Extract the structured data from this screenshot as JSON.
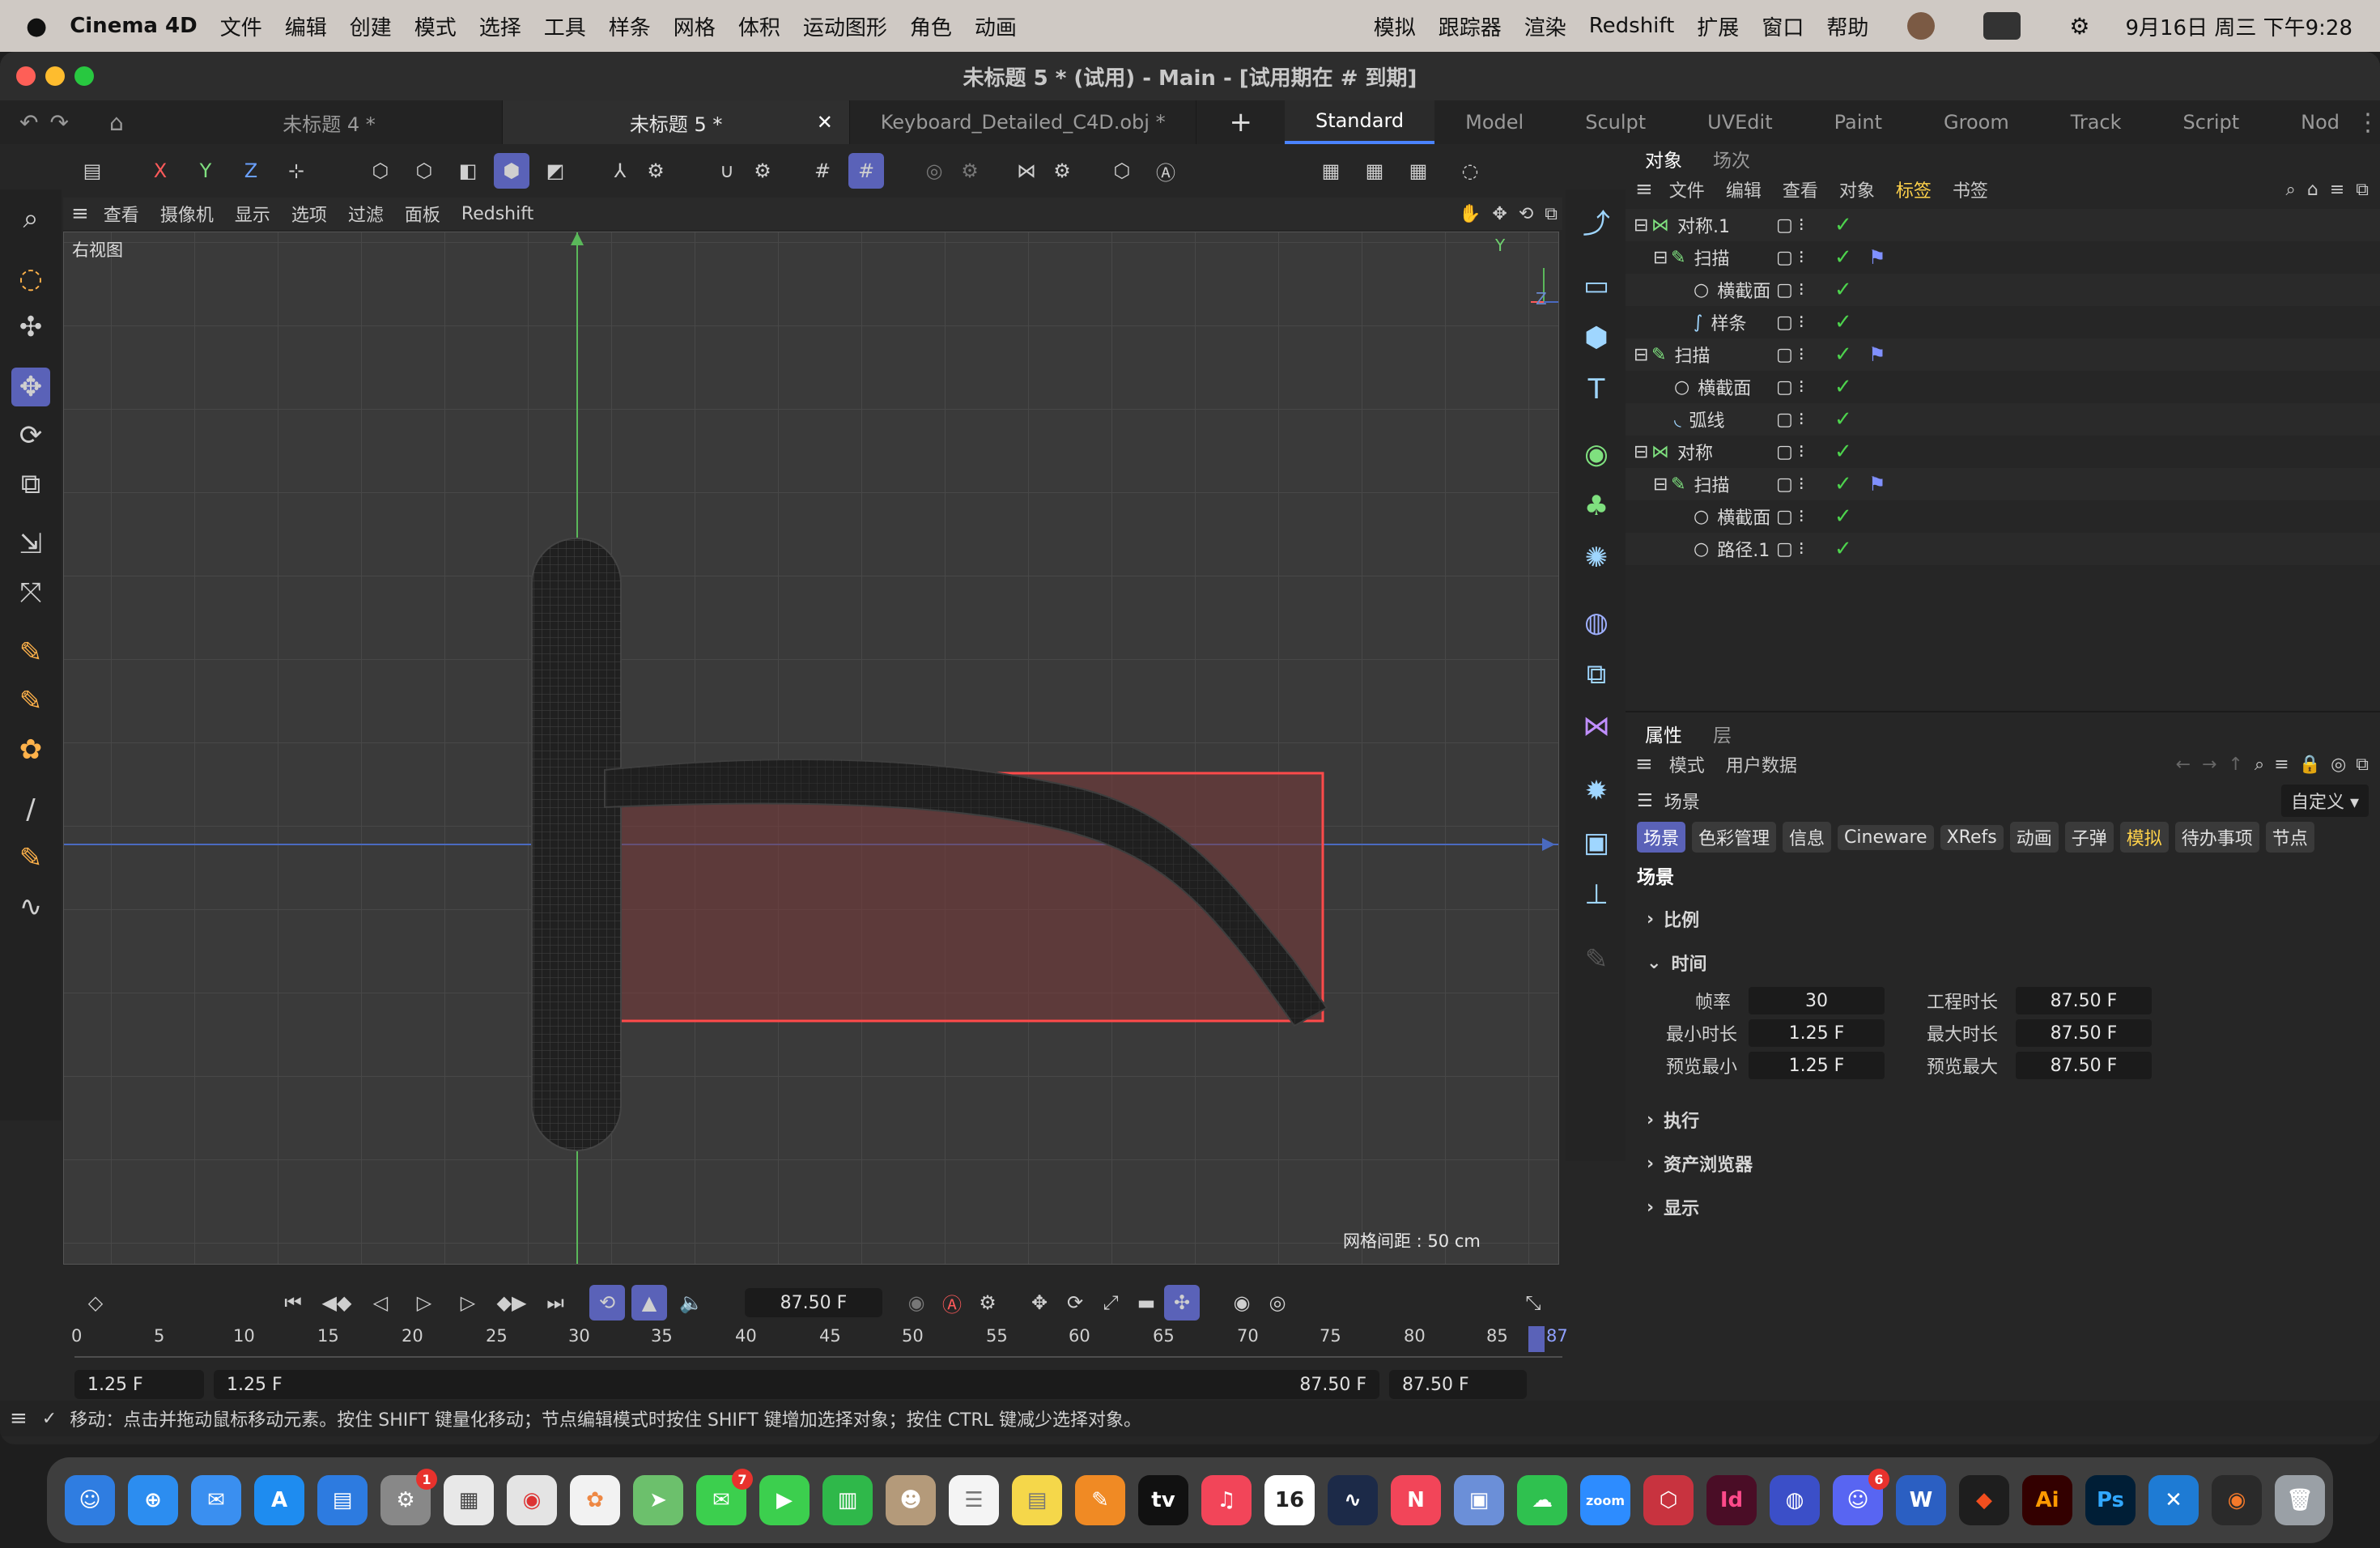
{
  "menubar": {
    "app": "Cinema 4D",
    "items": [
      "文件",
      "编辑",
      "创建",
      "模式",
      "选择",
      "工具",
      "样条",
      "网格",
      "体积",
      "运动图形",
      "角色",
      "动画"
    ],
    "right_items": [
      "模拟",
      "跟踪器",
      "渲染",
      "Redshift",
      "扩展",
      "窗口",
      "帮助"
    ],
    "clock": "9月16日 周三  下午9:28"
  },
  "window": {
    "title": "未标题 5 * (试用) - Main - [试用期在 # 到期]",
    "doc_tabs": [
      {
        "label": "未标题 4 *"
      },
      {
        "label": "未标题 5 *",
        "close": "✕"
      },
      {
        "label": "Keyboard_Detailed_C4D.obj *"
      }
    ],
    "add_tab": "+",
    "layouts": [
      "Standard",
      "Model",
      "Sculpt",
      "UVEdit",
      "Paint",
      "Groom",
      "Track",
      "Script",
      "Nod"
    ],
    "axes": {
      "x": "X",
      "y": "Y",
      "z": "Z"
    }
  },
  "viewport": {
    "menu": [
      "查看",
      "摄像机",
      "显示",
      "选项",
      "过滤",
      "面板",
      "Redshift"
    ],
    "name": "右视图",
    "grid_note": "网格间距 : 50 cm",
    "axis_y": "Y",
    "axis_z": "Z"
  },
  "timeline": {
    "current_frame": "87.50 F",
    "ruler": [
      "0",
      "5",
      "10",
      "15",
      "20",
      "25",
      "30",
      "35",
      "40",
      "45",
      "50",
      "55",
      "60",
      "65",
      "70",
      "75",
      "80",
      "85",
      "87"
    ],
    "range_min": "1.25 F",
    "range_start": "1.25 F",
    "range_end": "87.50 F",
    "range_max": "87.50 F"
  },
  "status": {
    "text": "移动：点击并拖动鼠标移动元素。按住 SHIFT 键量化移动；节点编辑模式时按住 SHIFT 键增加选择对象；按住 CTRL 键减少选择对象。"
  },
  "objects": {
    "tabs": [
      "对象",
      "场次"
    ],
    "menu": [
      "文件",
      "编辑",
      "查看",
      "对象",
      "标签",
      "书签"
    ],
    "rows": [
      {
        "name": "对称.1",
        "indent": 0,
        "icon": "symmetry-icon",
        "tag": false
      },
      {
        "name": "扫描",
        "indent": 1,
        "icon": "sweep-icon",
        "tag": true
      },
      {
        "name": "横截面",
        "indent": 2,
        "icon": "circle-icon",
        "tag": false
      },
      {
        "name": "样条",
        "indent": 2,
        "icon": "spline-icon",
        "tag": false
      },
      {
        "name": "扫描",
        "indent": 0,
        "icon": "sweep-icon",
        "tag": true
      },
      {
        "name": "横截面",
        "indent": 1,
        "icon": "circle-icon",
        "tag": false
      },
      {
        "name": "弧线",
        "indent": 1,
        "icon": "arc-icon",
        "tag": false
      },
      {
        "name": "对称",
        "indent": 0,
        "icon": "symmetry-icon",
        "tag": false
      },
      {
        "name": "扫描",
        "indent": 1,
        "icon": "sweep-icon",
        "tag": true
      },
      {
        "name": "横截面",
        "indent": 2,
        "icon": "circle-icon",
        "tag": false
      },
      {
        "name": "路径.1",
        "indent": 2,
        "icon": "circle-icon",
        "tag": false
      }
    ]
  },
  "attributes": {
    "tabs": [
      "属性",
      "层"
    ],
    "menu": [
      "模式",
      "用户数据"
    ],
    "scene_label": "场景",
    "preset": "自定义",
    "sub_tabs": [
      "场景",
      "色彩管理",
      "信息",
      "Cineware",
      "XRefs",
      "动画",
      "子弹",
      "模拟",
      "待办事项",
      "节点"
    ],
    "heading": "场景",
    "sections": {
      "scale": "比例",
      "time": "时间",
      "exec": "执行",
      "asset": "资产浏览器",
      "display": "显示"
    },
    "fields": {
      "fps_label": "帧率",
      "fps": "30",
      "proj_len_label": "工程时长",
      "proj_len": "87.50 F",
      "min_len_label": "最小时长",
      "min_len": "1.25 F",
      "max_len_label": "最大时长",
      "max_len": "87.50 F",
      "prev_min_label": "预览最小",
      "prev_min": "1.25 F",
      "prev_max_label": "预览最大",
      "prev_max": "87.50 F"
    }
  },
  "dock": {
    "badges": {
      "settings": "1",
      "messages": "7",
      "discord": "6"
    },
    "calendar_day": "16",
    "tv_label": "tv",
    "zoom_label": "zoom",
    "id_label": "Id",
    "ai_label": "Ai",
    "ps_label": "Ps"
  },
  "colors": {
    "accent": "#5a62b8",
    "check": "#4dd34d",
    "selection_rect": "#7a3a3a"
  }
}
